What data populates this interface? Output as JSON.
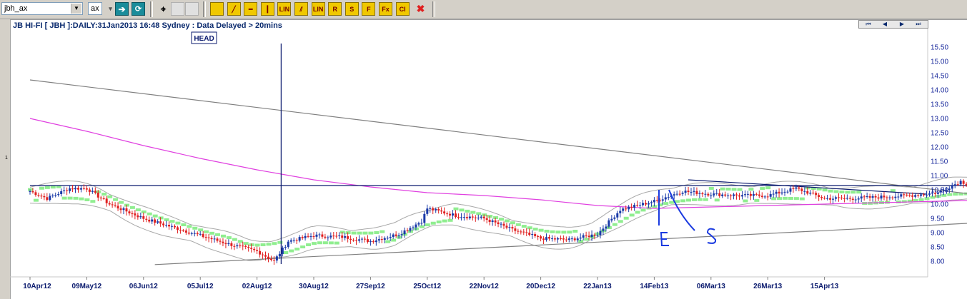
{
  "toolbar": {
    "symbol_value": "jbh_ax",
    "exchange_value": "ax",
    "arrow_icon_1": "forward-arrow-icon",
    "arrow_icon_2": "refresh-icon",
    "binoculars_icon": "binoculars-icon",
    "drawing_tools": [
      {
        "icon": "pencil-icon",
        "label": ""
      },
      {
        "icon": "line-icon",
        "label": "╱"
      },
      {
        "icon": "horizontal-line-icon",
        "label": "━"
      },
      {
        "icon": "vertical-line-icon",
        "label": "┃"
      },
      {
        "icon": "lin-icon",
        "label": "LIN"
      },
      {
        "icon": "parallel-lines-icon",
        "label": "⫽"
      },
      {
        "icon": "lin-underline-icon",
        "label": "LIN"
      },
      {
        "icon": "r-icon",
        "label": "R"
      },
      {
        "icon": "s-icon",
        "label": "S"
      },
      {
        "icon": "f-icon",
        "label": "F"
      },
      {
        "icon": "fx-icon",
        "label": "Fx"
      },
      {
        "icon": "ci-icon",
        "label": "CI"
      }
    ],
    "delete_icon": "delete-x-icon"
  },
  "left_label": "1",
  "title": "JB HI-FI [ JBH ]:DAILY:31Jan2013 16:48 Sydney : Data Delayed > 20mins",
  "nav": [
    "⏮",
    "◀",
    "▶",
    "⏭"
  ],
  "annotations": {
    "head": "HEAD",
    "e": "E",
    "s": "S"
  },
  "colors": {
    "up": "#1a3aa8",
    "down": "#e02020",
    "ma": "#e040e0",
    "stop": "#90ee90",
    "trend": "#808080",
    "hline": "#0a1a6e"
  },
  "chart_data": {
    "type": "candlestick",
    "title": "JB HI-FI [ JBH ]:DAILY:31Jan2013 16:48 Sydney : Data Delayed > 20mins",
    "ylim": [
      7.75,
      15.75
    ],
    "y_ticks": [
      8.0,
      8.5,
      9.0,
      9.5,
      10.0,
      10.5,
      11.0,
      11.5,
      12.0,
      12.5,
      13.0,
      13.5,
      14.0,
      14.5,
      15.0,
      15.5
    ],
    "x_ticks": [
      "10Apr12",
      "09May12",
      "06Jun12",
      "05Jul12",
      "02Aug12",
      "30Aug12",
      "27Sep12",
      "25Oct12",
      "22Nov12",
      "20Dec12",
      "22Jan13",
      "14Feb13",
      "06Mar13",
      "26Mar13",
      "15Apr13"
    ],
    "close_points": [
      {
        "t": 0.0,
        "v": 10.45
      },
      {
        "t": 0.3,
        "v": 10.2
      },
      {
        "t": 0.7,
        "v": 10.55
      },
      {
        "t": 1.0,
        "v": 10.55
      },
      {
        "t": 1.4,
        "v": 10.0
      },
      {
        "t": 2.0,
        "v": 9.5
      },
      {
        "t": 2.5,
        "v": 9.2
      },
      {
        "t": 3.0,
        "v": 8.9
      },
      {
        "t": 3.5,
        "v": 8.6
      },
      {
        "t": 4.0,
        "v": 8.35
      },
      {
        "t": 4.3,
        "v": 8.0
      },
      {
        "t": 4.55,
        "v": 8.7
      },
      {
        "t": 5.0,
        "v": 8.9
      },
      {
        "t": 5.5,
        "v": 8.85
      },
      {
        "t": 6.0,
        "v": 8.7
      },
      {
        "t": 6.5,
        "v": 8.95
      },
      {
        "t": 6.9,
        "v": 9.4
      },
      {
        "t": 7.0,
        "v": 9.85
      },
      {
        "t": 7.5,
        "v": 9.6
      },
      {
        "t": 8.0,
        "v": 9.5
      },
      {
        "t": 8.5,
        "v": 9.1
      },
      {
        "t": 9.0,
        "v": 8.8
      },
      {
        "t": 9.5,
        "v": 8.75
      },
      {
        "t": 10.0,
        "v": 8.95
      },
      {
        "t": 10.4,
        "v": 9.8
      },
      {
        "t": 11.0,
        "v": 10.1
      },
      {
        "t": 11.5,
        "v": 10.45
      },
      {
        "t": 12.0,
        "v": 10.35
      },
      {
        "t": 12.5,
        "v": 10.3
      },
      {
        "t": 13.0,
        "v": 10.3
      },
      {
        "t": 13.5,
        "v": 10.55
      },
      {
        "t": 14.0,
        "v": 10.2
      },
      {
        "t": 14.5,
        "v": 10.2
      },
      {
        "t": 15.0,
        "v": 10.25
      },
      {
        "t": 15.5,
        "v": 10.3
      },
      {
        "t": 16.0,
        "v": 10.4
      },
      {
        "t": 16.4,
        "v": 10.8
      },
      {
        "t": 16.8,
        "v": 10.45
      },
      {
        "t": 17.1,
        "v": 10.35
      },
      {
        "t": 17.4,
        "v": 10.1
      },
      {
        "t": 17.6,
        "v": 9.9
      }
    ],
    "ma_line": [
      {
        "t": 0.0,
        "v": 13.0
      },
      {
        "t": 1.0,
        "v": 12.55
      },
      {
        "t": 2.0,
        "v": 12.05
      },
      {
        "t": 3.0,
        "v": 11.6
      },
      {
        "t": 4.0,
        "v": 11.2
      },
      {
        "t": 5.0,
        "v": 10.85
      },
      {
        "t": 6.0,
        "v": 10.6
      },
      {
        "t": 7.0,
        "v": 10.4
      },
      {
        "t": 8.0,
        "v": 10.3
      },
      {
        "t": 9.0,
        "v": 10.15
      },
      {
        "t": 10.0,
        "v": 9.95
      },
      {
        "t": 11.0,
        "v": 9.85
      },
      {
        "t": 12.0,
        "v": 9.9
      },
      {
        "t": 13.0,
        "v": 9.95
      },
      {
        "t": 14.0,
        "v": 10.0
      },
      {
        "t": 15.0,
        "v": 10.05
      },
      {
        "t": 16.0,
        "v": 10.1
      },
      {
        "t": 17.0,
        "v": 10.15
      },
      {
        "t": 17.6,
        "v": 10.2
      }
    ],
    "trend_lines": [
      {
        "t1": 0.0,
        "v1": 14.35,
        "t2": 18.95,
        "v2": 9.78
      },
      {
        "t1": 2.2,
        "v1": 7.88,
        "t2": 18.75,
        "v2": 9.55
      },
      {
        "t1": 0.0,
        "v1": 10.65,
        "t2": 17.9,
        "v2": 10.65
      },
      {
        "t1": 11.6,
        "v1": 10.85,
        "t2": 15.8,
        "v2": 10.35
      }
    ],
    "head_marker": {
      "t": 4.4,
      "label": "HEAD"
    }
  }
}
